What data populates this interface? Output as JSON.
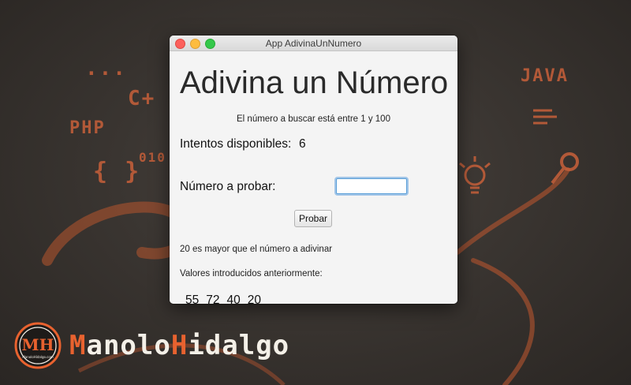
{
  "background": {
    "labels": [
      "...",
      "C+",
      "PHP",
      "{ }",
      "010",
      "JAVA"
    ]
  },
  "window": {
    "title": "App AdivinaUnNumero",
    "heading": "Adivina un Número",
    "range_text": "El número a buscar está entre 1 y 100",
    "attempts_label": "Intentos disponibles:",
    "attempts_value": "6",
    "guess_label": "Número a probar:",
    "guess_value": "",
    "guess_placeholder": "",
    "try_button": "Probar",
    "hint_text": "20 es mayor que el número a adivinar",
    "previous_label": "Valores introducidos anteriormente:",
    "previous_values": [
      "55",
      "72",
      "40",
      "20"
    ]
  },
  "branding": {
    "logo_letters": "MH",
    "logo_caption": "ManoloHidalgo.com",
    "first": "Manolo",
    "first_initial": "M",
    "first_rest": "anolo",
    "last_initial": "H",
    "last_rest": "idalgo"
  },
  "colors": {
    "accent_orange": "#e8622f",
    "focus_blue": "#5a9fd8",
    "close": "#fc605c",
    "minimize": "#fdbc40",
    "maximize": "#34c84a"
  }
}
